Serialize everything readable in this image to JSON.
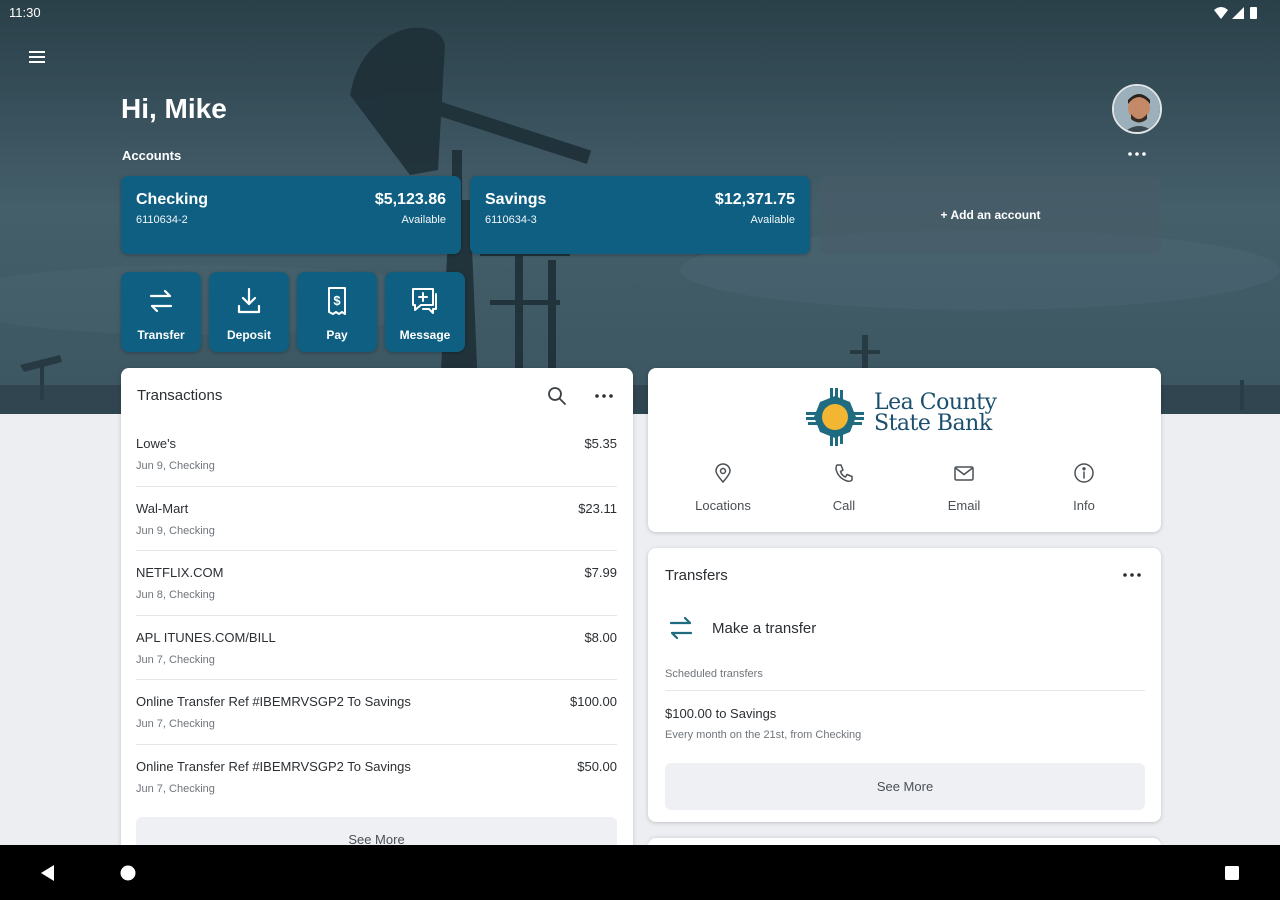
{
  "status": {
    "time": "11:30"
  },
  "header": {
    "greeting": "Hi, Mike",
    "accounts_label": "Accounts"
  },
  "accounts": [
    {
      "name": "Checking",
      "number": "6110634-2",
      "balance": "$5,123.86",
      "balance_label": "Available"
    },
    {
      "name": "Savings",
      "number": "6110634-3",
      "balance": "$12,371.75",
      "balance_label": "Available"
    }
  ],
  "add_account": {
    "label": "+ Add an account"
  },
  "quick_actions": [
    {
      "label": "Transfer",
      "icon": "transfer-icon"
    },
    {
      "label": "Deposit",
      "icon": "deposit-icon"
    },
    {
      "label": "Pay",
      "icon": "pay-icon"
    },
    {
      "label": "Message",
      "icon": "message-icon"
    }
  ],
  "transactions": {
    "title": "Transactions",
    "items": [
      {
        "merchant": "Lowe's",
        "amount": "$5.35",
        "sub": "Jun 9, Checking"
      },
      {
        "merchant": "Wal-Mart",
        "amount": "$23.11",
        "sub": "Jun 9, Checking"
      },
      {
        "merchant": "NETFLIX.COM",
        "amount": "$7.99",
        "sub": "Jun 8, Checking"
      },
      {
        "merchant": "APL ITUNES.COM/BILL",
        "amount": "$8.00",
        "sub": "Jun 7, Checking"
      },
      {
        "merchant": "Online Transfer Ref #IBEMRVSGP2 To Savings",
        "amount": "$100.00",
        "sub": "Jun 7, Checking"
      },
      {
        "merchant": "Online Transfer Ref #IBEMRVSGP2 To Savings",
        "amount": "$50.00",
        "sub": "Jun 7, Checking"
      }
    ],
    "see_more": "See More"
  },
  "bank": {
    "logo_line1": "Lea County",
    "logo_line2": "State Bank",
    "contacts": [
      {
        "label": "Locations",
        "icon": "location-pin-icon"
      },
      {
        "label": "Call",
        "icon": "phone-icon"
      },
      {
        "label": "Email",
        "icon": "email-icon"
      },
      {
        "label": "Info",
        "icon": "info-icon"
      }
    ]
  },
  "transfers": {
    "title": "Transfers",
    "make_label": "Make a transfer",
    "scheduled_label": "Scheduled transfers",
    "scheduled": [
      {
        "title": "$100.00 to Savings",
        "detail": "Every month on the 21st, from Checking"
      }
    ],
    "see_more": "See More"
  },
  "colors": {
    "primary": "#0f5f82",
    "logo_blue": "#1b4f6e",
    "logo_teal": "#1f6b7f",
    "logo_sun": "#f2b632"
  }
}
